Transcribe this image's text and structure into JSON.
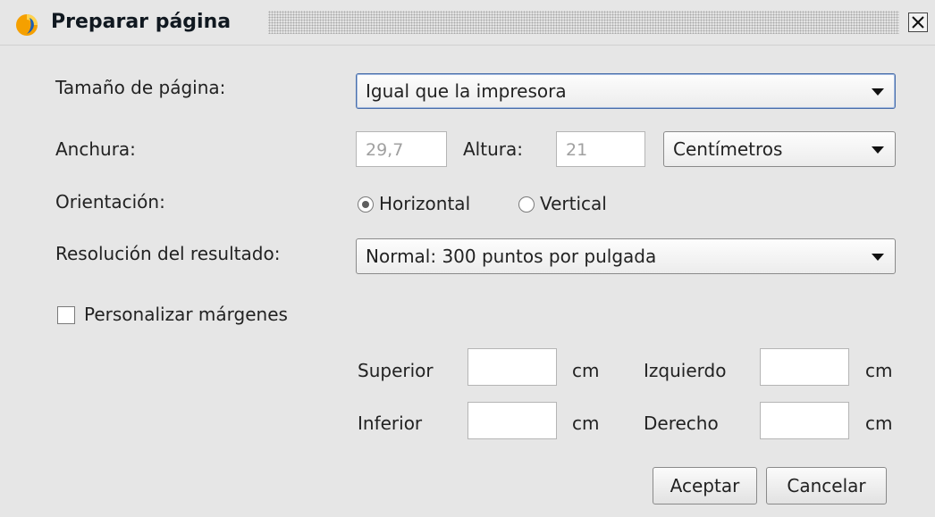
{
  "window": {
    "title": "Preparar página",
    "close_icon": "close-icon"
  },
  "form": {
    "page_size_label": "Tamaño de página:",
    "page_size_value": "Igual que la impresora",
    "width_label": "Anchura:",
    "width_value": "29,7",
    "height_label": "Altura:",
    "height_value": "21",
    "units_value": "Centímetros",
    "orientation_label": "Orientación:",
    "orientation_options": [
      "Horizontal",
      "Vertical"
    ],
    "orientation_selected": "Horizontal",
    "resolution_label": "Resolución del resultado:",
    "resolution_value": "Normal: 300 puntos por pulgada",
    "custom_margins_label": "Personalizar márgenes",
    "custom_margins_checked": false
  },
  "margins": {
    "top_label": "Superior",
    "bottom_label": "Inferior",
    "left_label": "Izquierdo",
    "right_label": "Derecho",
    "unit": "cm",
    "top_value": "",
    "bottom_value": "",
    "left_value": "",
    "right_value": ""
  },
  "buttons": {
    "ok": "Aceptar",
    "cancel": "Cancelar"
  }
}
